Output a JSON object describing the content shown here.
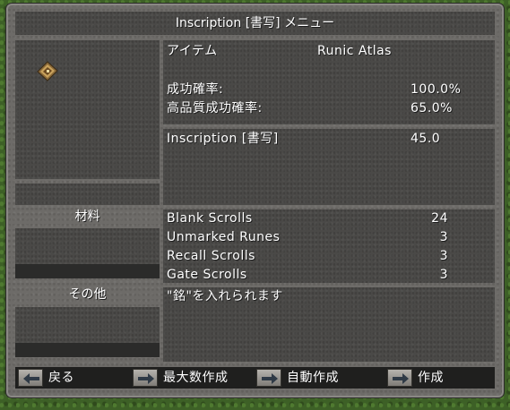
{
  "window": {
    "title": "Inscription [書写] メニュー"
  },
  "item": {
    "label": "アイテム",
    "name": "Runic Atlas",
    "icon": "runebook-icon"
  },
  "stats": [
    {
      "label": "成功確率:",
      "value": "100.0%"
    },
    {
      "label": "高品質成功確率:",
      "value": "65.0%"
    }
  ],
  "skill": {
    "label": "Inscription [書写]",
    "value": "45.0"
  },
  "materials": {
    "header": "材料",
    "rows": [
      {
        "name": "Blank Scrolls",
        "qty": "24"
      },
      {
        "name": "Unmarked Runes",
        "qty": "3"
      },
      {
        "name": "Recall Scrolls",
        "qty": "3"
      },
      {
        "name": "Gate Scrolls",
        "qty": "3"
      }
    ]
  },
  "other": {
    "header": "その他",
    "note": "\"銘\"を入れられます"
  },
  "buttons": {
    "back": "戻る",
    "make_max": "最大数作成",
    "auto_make": "自動作成",
    "make": "作成"
  }
}
